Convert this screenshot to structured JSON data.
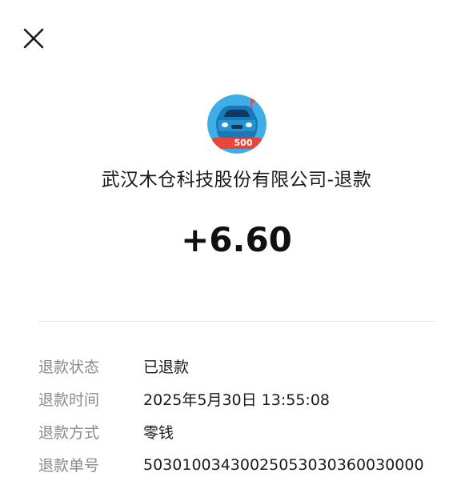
{
  "header": {
    "close_icon": "close-icon"
  },
  "merchant": {
    "avatar_badge": "500",
    "name": "武汉木仓科技股份有限公司-退款"
  },
  "amount": "+6.60",
  "details": [
    {
      "label": "退款状态",
      "value": "已退款"
    },
    {
      "label": "退款时间",
      "value": "2025年5月30日 13:55:08"
    },
    {
      "label": "退款方式",
      "value": "零钱"
    },
    {
      "label": "退款单号",
      "value": "50301003430025053030360030000"
    }
  ],
  "colors": {
    "avatar_bg": "#2fa8e4",
    "badge_red": "#e8463a",
    "label_gray": "#8a8a8a",
    "divider": "#e8e8e8"
  }
}
